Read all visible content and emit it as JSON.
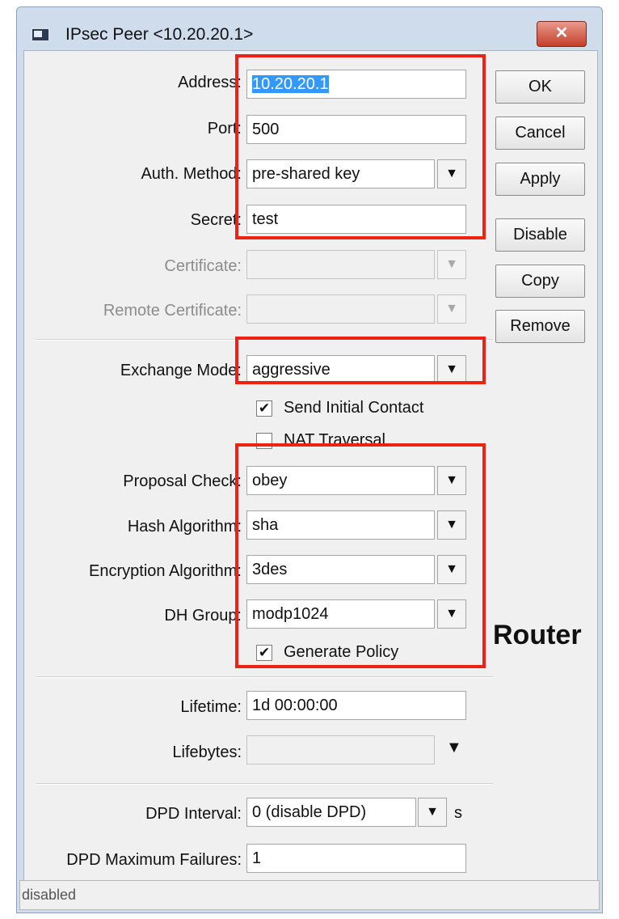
{
  "window": {
    "title": "IPsec Peer <10.20.20.1>",
    "close_label": "✕"
  },
  "fields": {
    "address": {
      "label": "Address:",
      "value": "10.20.20.1"
    },
    "port": {
      "label": "Port:",
      "value": "500"
    },
    "auth_method": {
      "label": "Auth. Method:",
      "value": "pre-shared key"
    },
    "secret": {
      "label": "Secret:",
      "value": "test"
    },
    "certificate": {
      "label": "Certificate:",
      "value": ""
    },
    "remote_certificate": {
      "label": "Remote Certificate:",
      "value": ""
    },
    "exchange_mode": {
      "label": "Exchange Mode:",
      "value": "aggressive"
    },
    "send_initial_contact": {
      "label": "Send Initial Contact",
      "checked": true
    },
    "nat_traversal": {
      "label": "NAT Traversal",
      "checked": false
    },
    "proposal_check": {
      "label": "Proposal Check:",
      "value": "obey"
    },
    "hash_algorithm": {
      "label": "Hash Algorithm:",
      "value": "sha"
    },
    "encryption_algorithm": {
      "label": "Encryption Algorithm:",
      "value": "3des"
    },
    "dh_group": {
      "label": "DH Group:",
      "value": "modp1024"
    },
    "generate_policy": {
      "label": "Generate Policy",
      "checked": true
    },
    "lifetime": {
      "label": "Lifetime:",
      "value": "1d 00:00:00"
    },
    "lifebytes": {
      "label": "Lifebytes:",
      "value": ""
    },
    "dpd_interval": {
      "label": "DPD Interval:",
      "value": "0 (disable DPD)",
      "unit": "s"
    },
    "dpd_max_failures": {
      "label": "DPD Maximum Failures:",
      "value": "1"
    }
  },
  "buttons": {
    "ok": "OK",
    "cancel": "Cancel",
    "apply": "Apply",
    "disable": "Disable",
    "copy": "Copy",
    "remove": "Remove"
  },
  "status_text": "disabled",
  "icons": {
    "dropdown": "▼",
    "dropdown_small": "▾",
    "check": "✔"
  },
  "overlay_text": "Router",
  "colors": {
    "highlight_box": "#ee2211",
    "selection": "#3399ff",
    "window_frame": "#cfdceb",
    "close_button": "#c33f2b"
  }
}
